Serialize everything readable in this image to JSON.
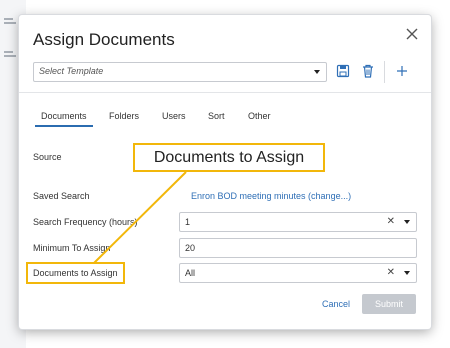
{
  "dialog": {
    "title": "Assign Documents"
  },
  "template": {
    "placeholder": "Select Template"
  },
  "toolbar": {
    "icons": [
      "save-icon",
      "delete-icon",
      "add-icon"
    ]
  },
  "tabs": [
    {
      "label": "Documents",
      "active": true
    },
    {
      "label": "Folders",
      "active": false
    },
    {
      "label": "Users",
      "active": false
    },
    {
      "label": "Sort",
      "active": false
    },
    {
      "label": "Other",
      "active": false
    }
  ],
  "form": {
    "source_label": "Source",
    "saved_search_label": "Saved Search",
    "saved_search_value": "Enron BOD meeting minutes (change...)",
    "search_frequency_label": "Search Frequency (hours)",
    "search_frequency_value": "1",
    "minimum_label": "Minimum To Assign",
    "minimum_value": "20",
    "docs_to_assign_label": "Documents to Assign",
    "docs_to_assign_value": "All"
  },
  "buttons": {
    "cancel": "Cancel",
    "submit": "Submit"
  },
  "annotation": {
    "callout_text": "Documents to Assign",
    "highlight_color": "#f2b70a"
  },
  "colors": {
    "link": "#2f6fb6",
    "active_tab": "#2b6cb0",
    "disabled_button": "#c5c9cf"
  }
}
